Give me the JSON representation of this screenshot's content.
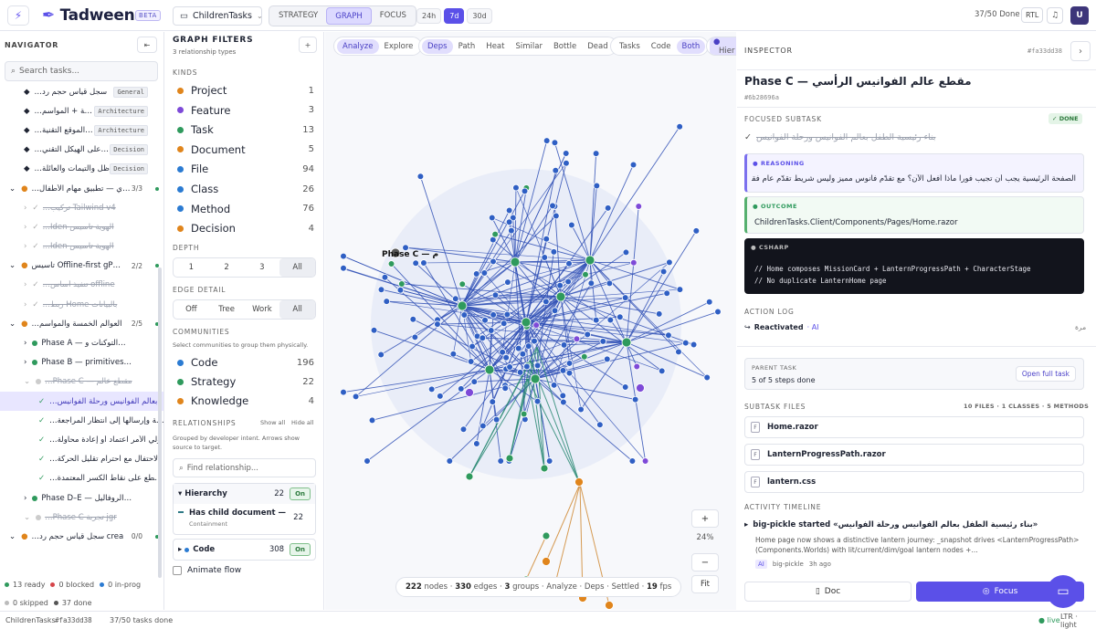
{
  "topbar": {
    "brand": "Tadweena",
    "beta": "BETA",
    "project": "ChildrenTasks",
    "modes": [
      "STRATEGY",
      "GRAPH",
      "FOCUS"
    ],
    "active_mode": "GRAPH",
    "ranges": [
      "24h",
      "7d",
      "30d"
    ],
    "active_range": "7d",
    "done": "37/50 Done",
    "rtl": "RTL",
    "user_initial": "U"
  },
  "navigator": {
    "title": "NAVIGATOR",
    "search_placeholder": "Search tasks...",
    "items": [
      {
        "label": "…سجل قياس حجم رد",
        "tag": "General",
        "kind": "tag"
      },
      {
        "label": "…مسة + المواسم",
        "tag": "Architecture",
        "kind": "tag"
      },
      {
        "label": "…سية الموقع التقنية",
        "tag": "Architecture",
        "kind": "tag"
      },
      {
        "label": "…اط على الهيكل التقني",
        "tag": "Decision",
        "kind": "tag"
      },
      {
        "label": "…ظل والتيمات والعائلة",
        "tag": "Decision",
        "kind": "tag"
      },
      {
        "label": "…سري — تطبيق مهام الأطفال",
        "count": "3/3",
        "kind": "group"
      },
      {
        "label": "…تركيب Tailwind v4",
        "kind": "done-sub"
      },
      {
        "label": "…Iden الهوية تأسيس",
        "kind": "done-sub"
      },
      {
        "label": "…Iden الهوية تأسيس",
        "kind": "done-sub"
      },
      {
        "label": "تأسيس Offline-first gP…",
        "count": "2/2",
        "kind": "group"
      },
      {
        "label": "…تنفيذ أساس offline",
        "kind": "done-sub"
      },
      {
        "label": "…ربط Home بالبيانات",
        "kind": "done-sub"
      },
      {
        "label": "…العوالم الخمسة والمواسم",
        "count": "2/5",
        "kind": "group"
      },
      {
        "label": "Phase A — التوكنات و…",
        "kind": "phase"
      },
      {
        "label": "Phase B — primitives…",
        "kind": "phase"
      },
      {
        "label": "…Phase C — مقطع عالم",
        "kind": "phase-open"
      },
      {
        "label": "…بعالم الفوانيس ورحلة الفوانيس",
        "kind": "selected"
      },
      {
        "label": "…مهمة وإرسالها إلى انتظار المراجعة",
        "kind": "check"
      },
      {
        "label": "…ولي الأمر اعتماد أو إعادة محاولة",
        "kind": "check"
      },
      {
        "label": "…الاحتفال مع احترام تقليل الحركة",
        "kind": "check"
      },
      {
        "label": "…لمقطع على نقاط الكسر المعتمدة",
        "kind": "check"
      },
      {
        "label": "Phase D–E — الروفاليل…",
        "kind": "phase"
      },
      {
        "label": "…Phase C تجربة jgr",
        "kind": "phase-open"
      },
      {
        "label": "…سجل قياس حجم رد crea",
        "count": "0/0",
        "kind": "group"
      }
    ],
    "footer": {
      "ready": "13 ready",
      "blocked": "0 blocked",
      "inprog": "0 in-prog",
      "skipped": "0 skipped",
      "done": "37 done"
    }
  },
  "filters": {
    "title": "GRAPH FILTERS",
    "subtitle": "3 relationship types",
    "kinds_label": "KINDS",
    "kinds": [
      {
        "name": "Project",
        "count": "1",
        "color": "#e0851c"
      },
      {
        "name": "Feature",
        "count": "3",
        "color": "#7e4ad8"
      },
      {
        "name": "Task",
        "count": "13",
        "color": "#2f9a5d"
      },
      {
        "name": "Document",
        "count": "5",
        "color": "#e0851c"
      },
      {
        "name": "File",
        "count": "94",
        "color": "#2b7bd2"
      },
      {
        "name": "Class",
        "count": "26",
        "color": "#2b7bd2"
      },
      {
        "name": "Method",
        "count": "76",
        "color": "#2b7bd2"
      },
      {
        "name": "Decision",
        "count": "4",
        "color": "#e0851c"
      }
    ],
    "depth_label": "DEPTH",
    "depth": [
      "1",
      "2",
      "3",
      "All"
    ],
    "edge_label": "EDGE DETAIL",
    "edge": [
      "Off",
      "Tree",
      "Work",
      "All"
    ],
    "communities_label": "COMMUNITIES",
    "communities_sub": "Select communities to group them physically.",
    "communities": [
      {
        "name": "Code",
        "count": "196",
        "color": "#2b7bd2"
      },
      {
        "name": "Strategy",
        "count": "22",
        "color": "#2f9a5d"
      },
      {
        "name": "Knowledge",
        "count": "4",
        "color": "#e0851c"
      }
    ],
    "relationships_label": "RELATIONSHIPS",
    "show_all": "Show all",
    "hide_all": "Hide all",
    "rel_note": "Grouped by developer intent. Arrows show source to target.",
    "rel_search": "Find relationship...",
    "hierarchy": {
      "label": "Hierarchy",
      "count": "22",
      "state": "On"
    },
    "has_child": {
      "label": "Has child document —",
      "sub": "Containment",
      "count": "22"
    },
    "code": {
      "label": "Code",
      "count": "308",
      "state": "On"
    },
    "animate": "Animate flow"
  },
  "canvas": {
    "tool1": [
      "Analyze",
      "Explore"
    ],
    "tool2": [
      "Deps",
      "Path",
      "Heat",
      "Similar",
      "Bottle",
      "Dead"
    ],
    "tool3": [
      "Tasks",
      "Code",
      "Both"
    ],
    "tool4": "Hier",
    "node_label": "Phase C — م",
    "zoom_in": "+",
    "zoom_pct": "24%",
    "zoom_out": "−",
    "fit": "Fit",
    "status": {
      "nodes": "222",
      "edges": "330",
      "groups": "3",
      "rest": "· Analyze · Deps · Settled ·",
      "fps": "19"
    }
  },
  "inspector": {
    "title": "INSPECTOR",
    "id": "#fa33dd38",
    "heading": "Phase C — مقطع عالم الفوانيس الرأسي",
    "heading_id": "#6b28696a",
    "focused_label": "FOCUSED SUBTASK",
    "done_badge": "✓ DONE",
    "focused_task": "بناء رئيسية الطفل بعالم الفوانيس ورحلة الفوانيس",
    "reasoning_label": "REASONING",
    "reasoning": "الصفحة الرئيسية يجب أن تجيب فوراً ماذا أفعل الآن؟ مع تقدّم فانوس مميز وليس شريط تقدّم عام فقط.",
    "outcome_label": "OUTCOME",
    "outcome": "ChildrenTasks.Client/Components/Pages/Home.razor",
    "csharp_label": "CSHARP",
    "code1": "// Home composes MissionCard + LanternProgressPath + CharacterStage",
    "code2": "// No duplicate LanternHome page",
    "action_label": "ACTION LOG",
    "action": "Reactivated",
    "action_by": "AI",
    "action_time": "مرة",
    "parent_label": "PARENT TASK",
    "parent_steps": "5 of 5 steps done",
    "open_full": "Open full task",
    "files_label": "SUBTASK FILES",
    "files_counts": "10 FILES · 1 CLASSES · 5 METHODS",
    "files": [
      "Home.razor",
      "LanternProgressPath.razor",
      "lantern.css"
    ],
    "timeline_label": "ACTIVITY TIMELINE",
    "tl_title": "big-pickle started «بناء رئيسية الطفل بعالم الفوانيس ورحلة الفوانيس»",
    "tl_body": "Home page now shows a distinctive lantern journey: _snapshot drives <LanternProgressPath> (Components.Worlds) with lit/current/dim/goal lantern nodes +...",
    "tl_user": "big-pickle",
    "tl_time": "3h ago",
    "btn_doc": "Doc",
    "btn_focus": "Focus"
  },
  "bottombar": {
    "project": "ChildrenTasks",
    "id": "#fa33dd38",
    "tasks": "37/50 tasks done",
    "live": "● live",
    "dir": "LTR · light"
  },
  "colors": {
    "accent": "#5b50e8",
    "edge": "#2f4fb5",
    "green": "#2f9a5d",
    "orange": "#e0851c",
    "purple": "#7e4ad8",
    "blue": "#2b7bd2"
  }
}
